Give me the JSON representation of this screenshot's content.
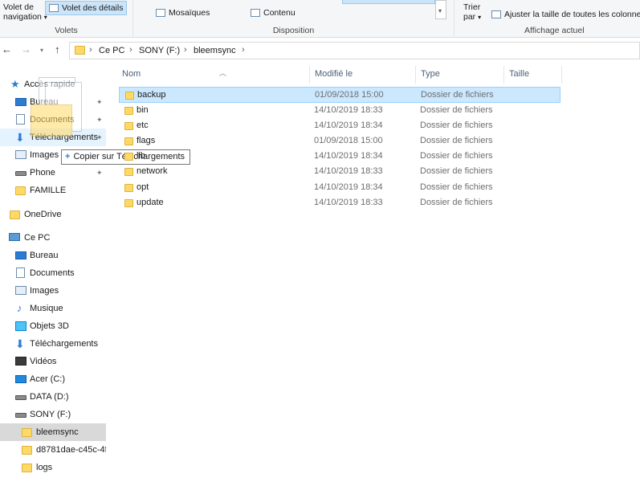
{
  "ribbon": {
    "volet_nav_label_1": "Volet de",
    "volet_nav_label_2": "navigation",
    "volet_details_label": "Volet des détails",
    "volets_group": "Volets",
    "disposition_items": [
      "Mosaïques",
      "Contenu"
    ],
    "disposition_group": "Disposition",
    "trier_label_1": "Trier",
    "trier_label_2": "par",
    "ajuster_label": "Ajuster la taille de toutes les colonnes",
    "affichage_group": "Affichage actuel"
  },
  "address": {
    "crumbs": [
      "Ce PC",
      "SONY (F:)",
      "bleemsync"
    ]
  },
  "sidebar": {
    "items": [
      {
        "label": "Accès rapide",
        "icon": "star-icon"
      },
      {
        "label": "Bureau",
        "icon": "desktop-icon"
      },
      {
        "label": "Documents",
        "icon": "documents-icon"
      },
      {
        "label": "Téléchargements",
        "icon": "download-icon"
      },
      {
        "label": "Images",
        "icon": "images-icon"
      },
      {
        "label": "Phone",
        "icon": "drive-icon"
      },
      {
        "label": "FAMILLE",
        "icon": "folder-icon"
      },
      {
        "label": "OneDrive",
        "icon": "folder-icon"
      },
      {
        "label": "Ce PC",
        "icon": "pc-icon"
      },
      {
        "label": "Bureau",
        "icon": "desktop-icon"
      },
      {
        "label": "Documents",
        "icon": "documents-icon"
      },
      {
        "label": "Images",
        "icon": "images-icon"
      },
      {
        "label": "Musique",
        "icon": "music-icon"
      },
      {
        "label": "Objets 3D",
        "icon": "cube-icon"
      },
      {
        "label": "Téléchargements",
        "icon": "download-icon"
      },
      {
        "label": "Vidéos",
        "icon": "video-icon"
      },
      {
        "label": "Acer (C:)",
        "icon": "windows-drive-icon"
      },
      {
        "label": "DATA (D:)",
        "icon": "drive-icon"
      },
      {
        "label": "SONY (F:)",
        "icon": "drive-icon"
      },
      {
        "label": "bleemsync",
        "icon": "folder-icon"
      },
      {
        "label": "d8781dae-c45c-4f",
        "icon": "folder-icon"
      },
      {
        "label": "logs",
        "icon": "folder-icon"
      }
    ]
  },
  "drag_tooltip": {
    "text": "Copier sur Téléchargements"
  },
  "table": {
    "columns": [
      "Nom",
      "Modifié le",
      "Type",
      "Taille"
    ],
    "rows": [
      {
        "name": "backup",
        "date": "01/09/2018 15:00",
        "type": "Dossier de fichiers"
      },
      {
        "name": "bin",
        "date": "14/10/2019 18:33",
        "type": "Dossier de fichiers"
      },
      {
        "name": "etc",
        "date": "14/10/2019 18:34",
        "type": "Dossier de fichiers"
      },
      {
        "name": "flags",
        "date": "01/09/2018 15:00",
        "type": "Dossier de fichiers"
      },
      {
        "name": "lib",
        "date": "14/10/2019 18:34",
        "type": "Dossier de fichiers"
      },
      {
        "name": "network",
        "date": "14/10/2019 18:33",
        "type": "Dossier de fichiers"
      },
      {
        "name": "opt",
        "date": "14/10/2019 18:34",
        "type": "Dossier de fichiers"
      },
      {
        "name": "update",
        "date": "14/10/2019 18:33",
        "type": "Dossier de fichiers"
      }
    ]
  }
}
